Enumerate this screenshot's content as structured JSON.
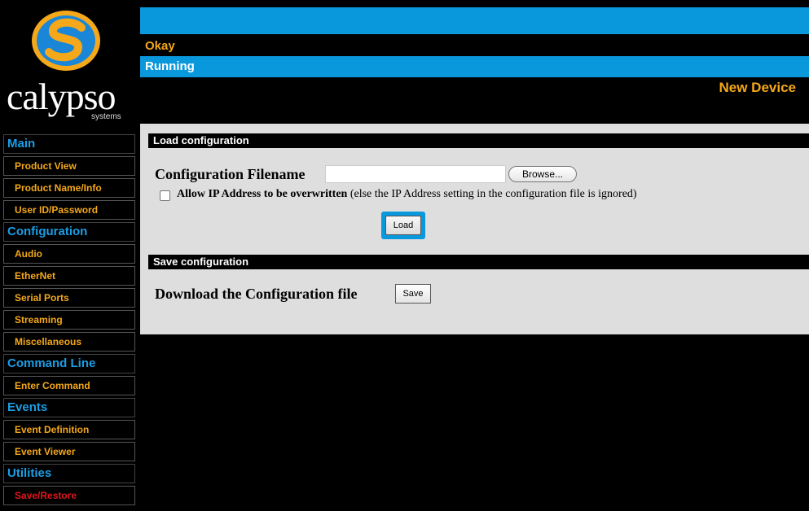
{
  "logo": {
    "text": "calypso",
    "subtext": "systems"
  },
  "status": {
    "okay": "Okay",
    "running": "Running",
    "device": "New Device"
  },
  "nav": {
    "main": "Main",
    "product_view": "Product View",
    "product_name_info": "Product Name/Info",
    "user_id_password": "User ID/Password",
    "configuration": "Configuration",
    "audio": "Audio",
    "ethernet": "EtherNet",
    "serial_ports": "Serial Ports",
    "streaming": "Streaming",
    "miscellaneous": "Miscellaneous",
    "command_line": "Command Line",
    "enter_command": "Enter Command",
    "events": "Events",
    "event_definition": "Event Definition",
    "event_viewer": "Event Viewer",
    "utilities": "Utilities",
    "save_restore": "Save/Restore"
  },
  "load_section": {
    "heading": "Load configuration",
    "filename_label": "Configuration Filename",
    "filename_value": "",
    "browse_label": "Browse...",
    "checkbox_bold": "Allow IP Address to be overwritten",
    "checkbox_rest": " (else the IP Address setting in the configuration file is ignored)",
    "load_label": "Load"
  },
  "save_section": {
    "heading": "Save configuration",
    "download_label": "Download the Configuration file",
    "save_label": "Save"
  },
  "colors": {
    "accent_blue": "#0a98dd",
    "accent_orange": "#f4a81a",
    "active_red": "#e0161a"
  }
}
